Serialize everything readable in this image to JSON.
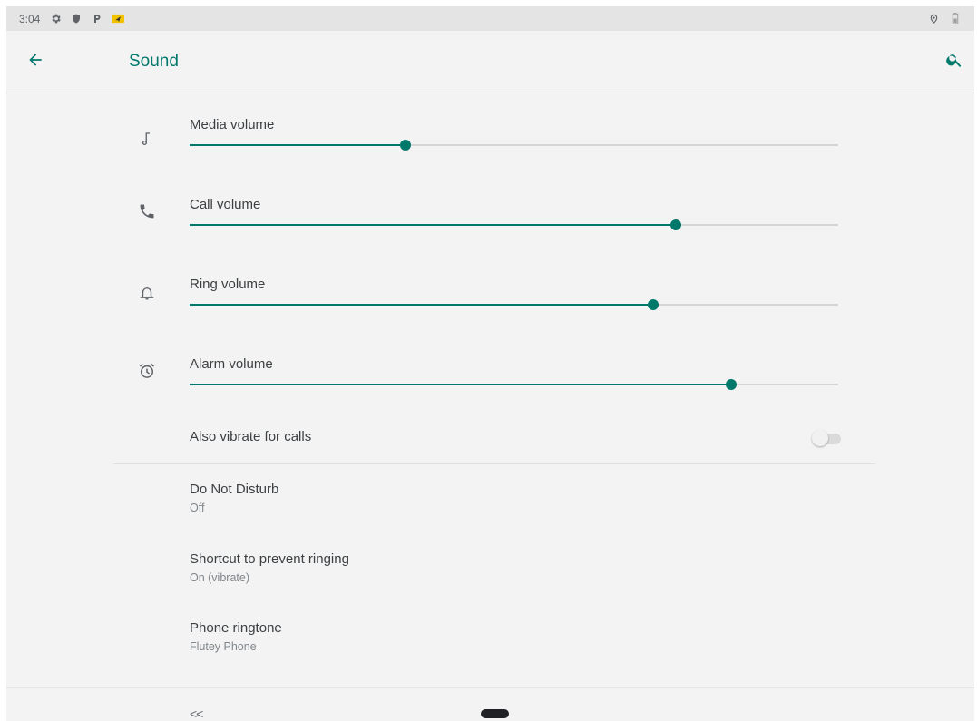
{
  "status_bar": {
    "time": "3:04",
    "icons": [
      "gear-icon",
      "shield-icon",
      "parking-icon",
      "notification-icon"
    ],
    "right_icons": [
      "location-icon",
      "battery-icon"
    ]
  },
  "app_bar": {
    "title": "Sound",
    "accent_color": "#00796b"
  },
  "volumes": [
    {
      "label": "Media volume",
      "icon": "music-note-icon",
      "level": 0.333
    },
    {
      "label": "Call volume",
      "icon": "phone-icon",
      "level": 0.75
    },
    {
      "label": "Ring volume",
      "icon": "bell-icon",
      "level": 0.715
    },
    {
      "label": "Alarm volume",
      "icon": "alarm-icon",
      "level": 0.835
    }
  ],
  "vibrate": {
    "label": "Also vibrate for calls",
    "enabled": false
  },
  "preferences": [
    {
      "title": "Do Not Disturb",
      "summary": "Off"
    },
    {
      "title": "Shortcut to prevent ringing",
      "summary": "On (vibrate)"
    },
    {
      "title": "Phone ringtone",
      "summary": "Flutey Phone"
    }
  ],
  "nav_bar": {
    "back_label": "<<"
  }
}
